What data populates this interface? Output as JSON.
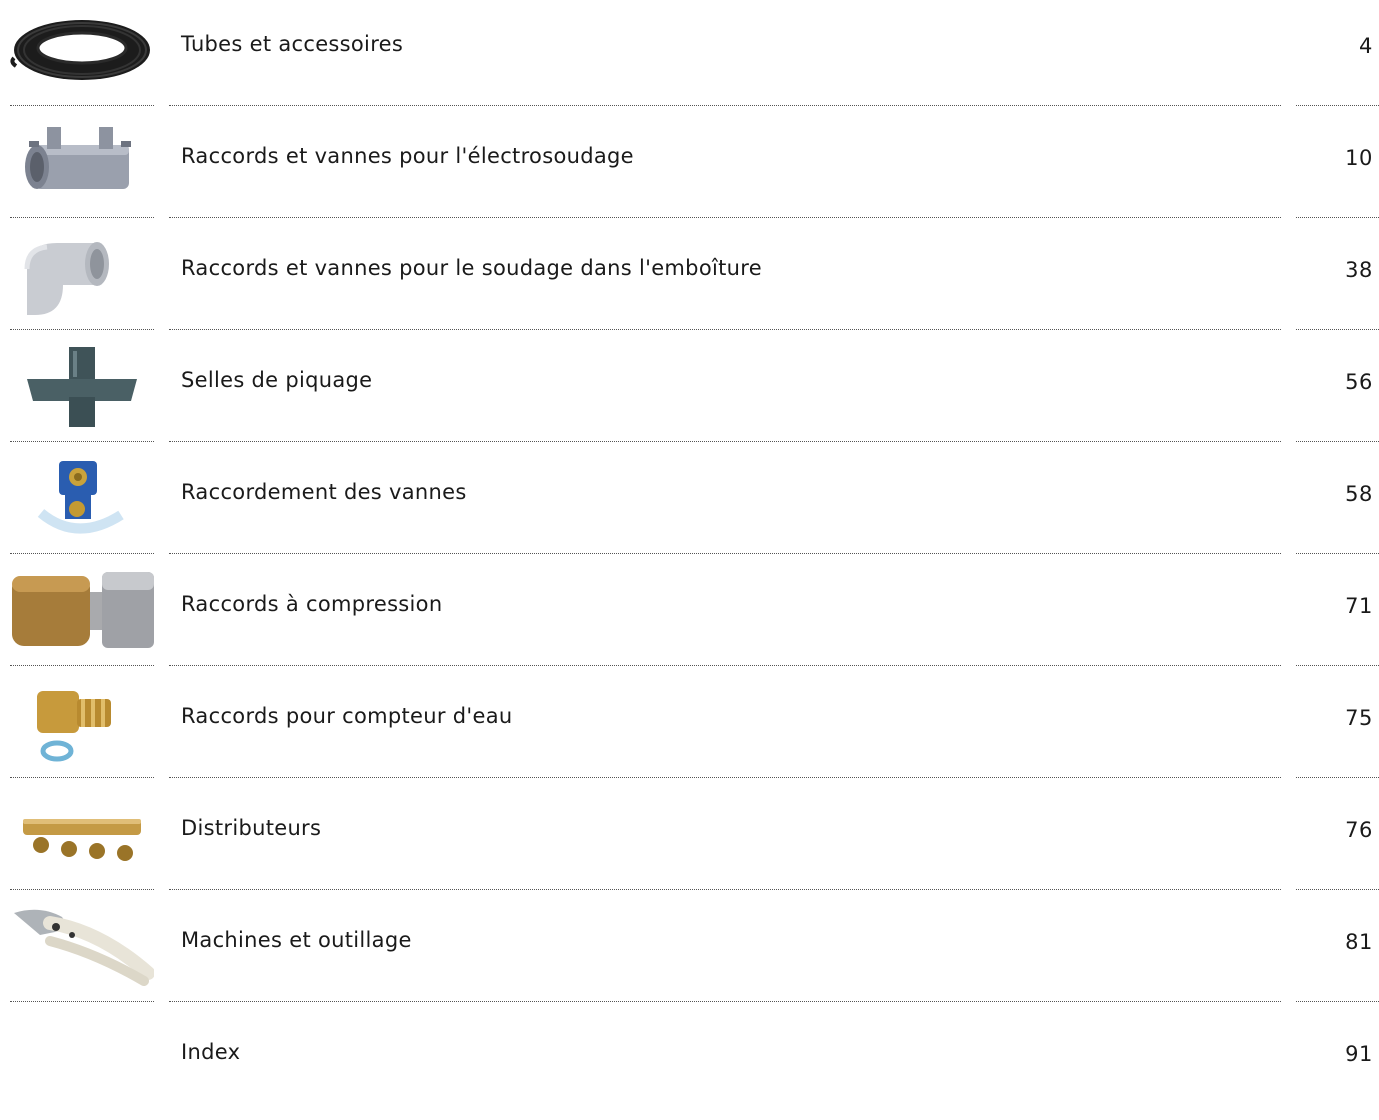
{
  "entries": [
    {
      "title": "Tubes et accessoires",
      "page": "4",
      "icon": "pipe-coil-icon"
    },
    {
      "title": "Raccords et vannes pour l'électrosoudage",
      "page": "10",
      "icon": "electrofusion-coupler-icon"
    },
    {
      "title": "Raccords et vannes pour le soudage dans l'emboîture",
      "page": "38",
      "icon": "socket-elbow-icon"
    },
    {
      "title": "Selles de piquage",
      "page": "56",
      "icon": "tapping-saddle-icon"
    },
    {
      "title": "Raccordement des vannes",
      "page": "58",
      "icon": "valve-connector-icon"
    },
    {
      "title": "Raccords à compression",
      "page": "71",
      "icon": "compression-fitting-icon"
    },
    {
      "title": "Raccords pour compteur d'eau",
      "page": "75",
      "icon": "water-meter-fitting-icon"
    },
    {
      "title": "Distributeurs",
      "page": "76",
      "icon": "manifold-icon"
    },
    {
      "title": "Machines et outillage",
      "page": "81",
      "icon": "pipe-cutter-icon"
    },
    {
      "title": "Index",
      "page": "91",
      "icon": ""
    }
  ]
}
